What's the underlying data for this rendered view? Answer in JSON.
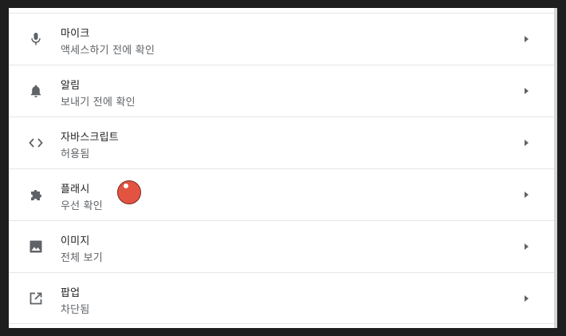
{
  "settings": {
    "items": [
      {
        "id": "microphone",
        "title": "마이크",
        "subtitle": "액세스하기 전에 확인",
        "icon": "microphone-icon"
      },
      {
        "id": "notifications",
        "title": "알림",
        "subtitle": "보내기 전에 확인",
        "icon": "bell-icon"
      },
      {
        "id": "javascript",
        "title": "자바스크립트",
        "subtitle": "허용됨",
        "icon": "code-icon"
      },
      {
        "id": "flash",
        "title": "플래시",
        "subtitle": "우선 확인",
        "icon": "puzzle-icon"
      },
      {
        "id": "images",
        "title": "이미지",
        "subtitle": "전체 보기",
        "icon": "image-icon"
      },
      {
        "id": "popups",
        "title": "팝업",
        "subtitle": "차단됨",
        "icon": "open-in-new-icon"
      }
    ]
  },
  "colors": {
    "icon": "#5f6368",
    "arrow": "#5f6368",
    "pointer_dot": "#e35342"
  }
}
